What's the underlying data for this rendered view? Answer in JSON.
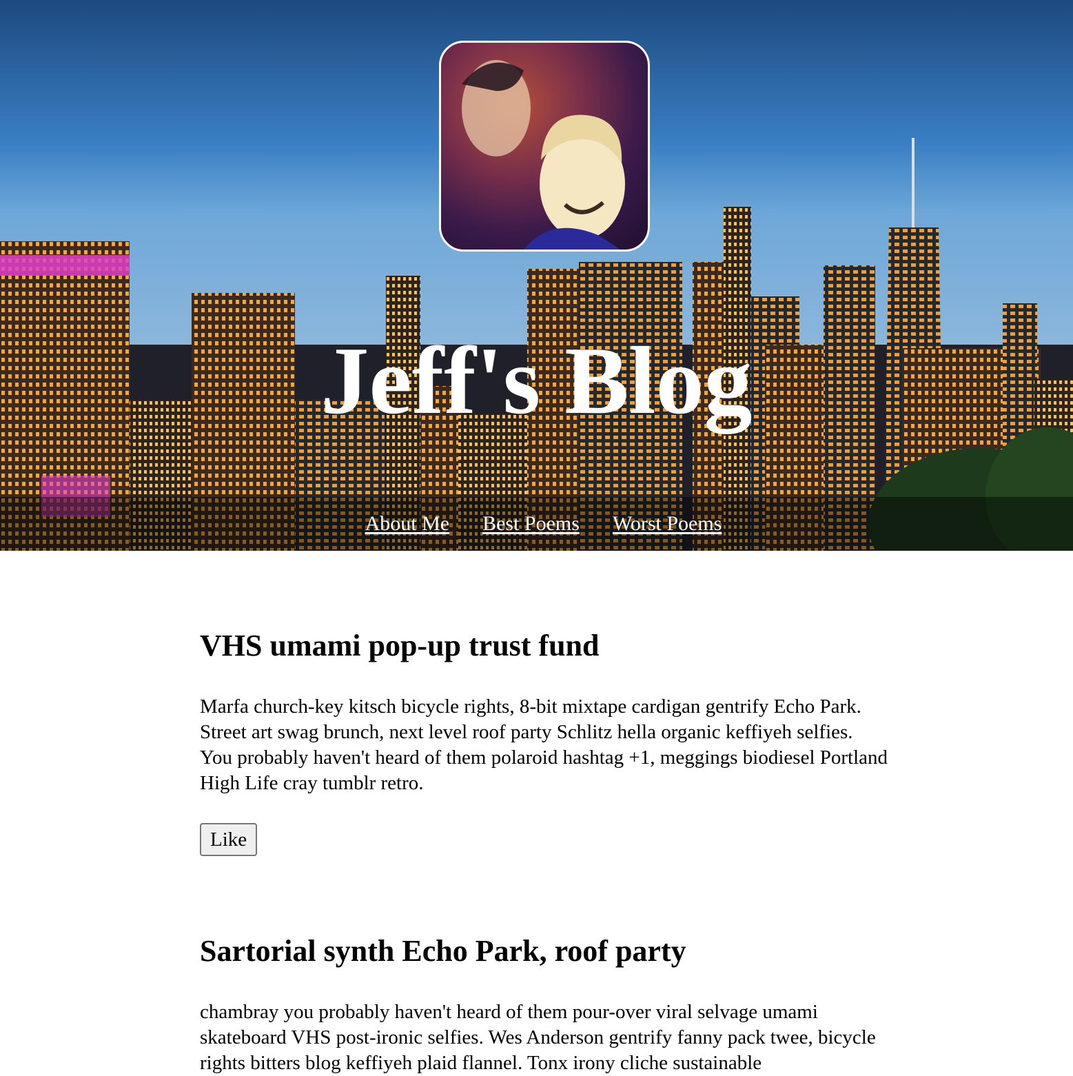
{
  "header": {
    "title": "Jeff's Blog",
    "avatar_alt": "Jeff profile photo",
    "nav": [
      {
        "label": "About Me"
      },
      {
        "label": "Best Poems"
      },
      {
        "label": "Worst Poems"
      }
    ]
  },
  "posts": [
    {
      "title": "VHS umami pop-up trust fund",
      "body": "Marfa church-key kitsch bicycle rights, 8-bit mixtape cardigan gentrify Echo Park. Street art swag brunch, next level roof party Schlitz hella organic keffiyeh selfies. You probably haven't heard of them polaroid hashtag +1, meggings biodiesel Portland High Life cray tumblr retro.",
      "like_label": "Like"
    },
    {
      "title": "Sartorial synth Echo Park, roof party",
      "body": "chambray you probably haven't heard of them pour-over viral selvage umami skateboard VHS post-ironic selfies. Wes Anderson gentrify fanny pack twee, bicycle rights bitters blog keffiyeh plaid flannel. Tonx irony cliche sustainable"
    }
  ],
  "colors": {
    "header_text": "#ffffff",
    "nav_bar": "rgba(0,0,0,0.45)",
    "sky_top": "#1f4f86",
    "sky_bottom": "#6aa6d8",
    "building_lights": "#f2a93b",
    "neon_pink": "#e040c8"
  }
}
